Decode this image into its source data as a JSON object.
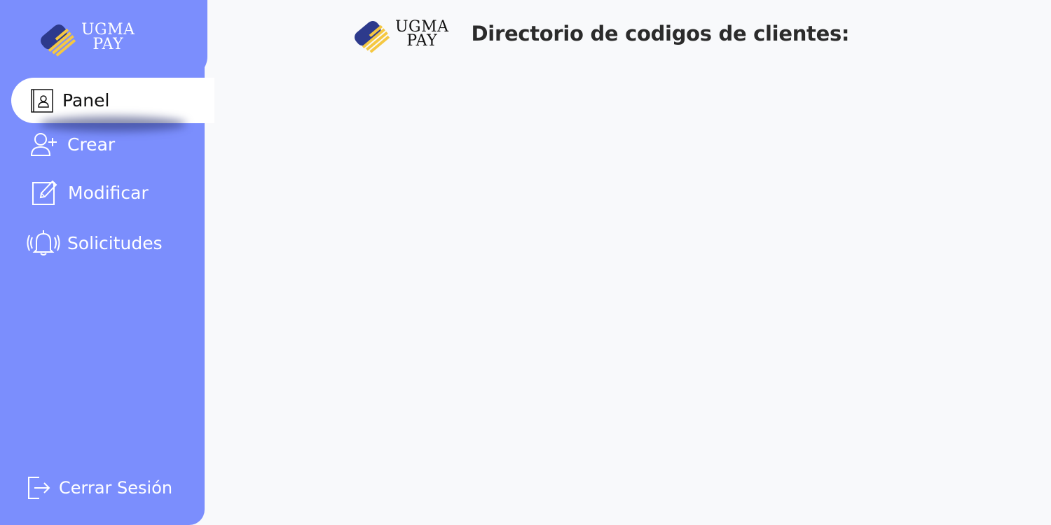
{
  "brand": {
    "line1": "UGMA",
    "line2": "PAY"
  },
  "sidebar": {
    "items": [
      {
        "label": "Panel",
        "icon": "contact-book-icon",
        "active": true
      },
      {
        "label": "Crear",
        "icon": "add-user-icon",
        "active": false
      },
      {
        "label": "Modificar",
        "icon": "edit-icon",
        "active": false
      },
      {
        "label": "Solicitudes",
        "icon": "bell-ringing-icon",
        "active": false
      }
    ],
    "logout_label": "Cerrar Sesión"
  },
  "header": {
    "title": "Directorio de codigos de clientes:"
  },
  "colors": {
    "sidebar": "#7b8efd",
    "background": "#f8f9fb",
    "logo_blue": "#2d3a8c",
    "logo_yellow": "#f5c842"
  }
}
